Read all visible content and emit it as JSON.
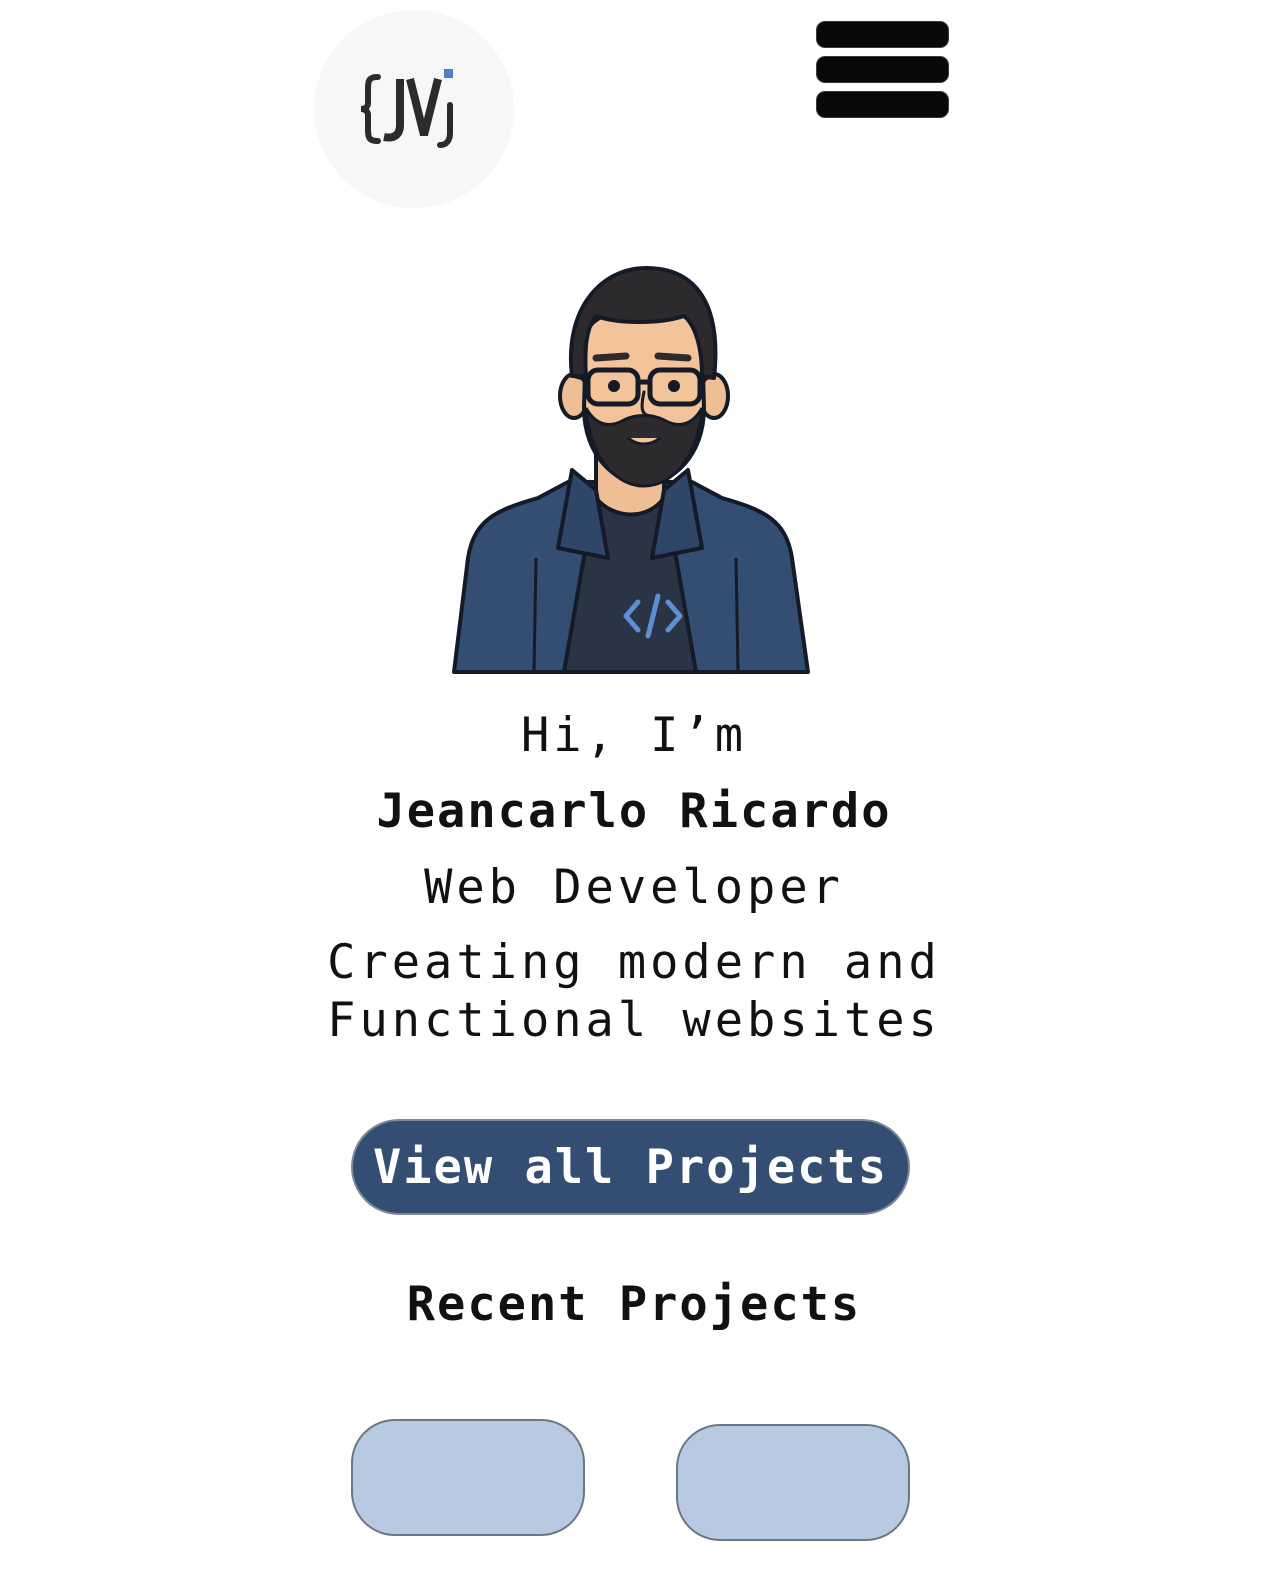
{
  "header": {
    "logo_icon": "jv-code-brace-logo-icon",
    "menu_icon": "hamburger-menu-icon"
  },
  "hero": {
    "avatar_icon": "developer-avatar-illustration",
    "greeting": "Hi, I’m",
    "name": "Jeancarlo Ricardo",
    "role": "Web Developer",
    "tagline_line1": "Creating modern and",
    "tagline_line2": "Functional websites"
  },
  "cta": {
    "label": "View all Projects"
  },
  "recent_projects": {
    "title": "Recent Projects",
    "cards": [
      {
        "label": ""
      },
      {
        "label": ""
      }
    ]
  },
  "colors": {
    "primary": "#344d72",
    "card": "#b8cae2",
    "logo_background": "#f7f7f7",
    "text": "#111111",
    "accent": "#4a7fc8"
  }
}
